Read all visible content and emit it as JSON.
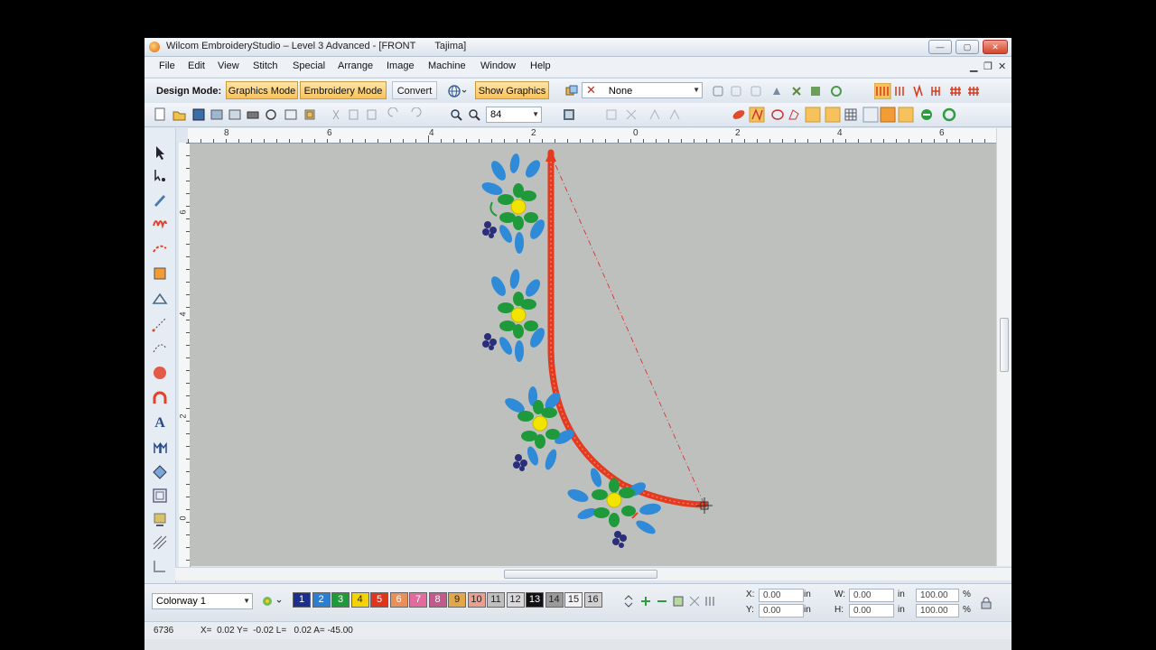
{
  "window": {
    "title": "Wilcom EmbroideryStudio – Level 3 Advanced - [FRONT       Tajima]"
  },
  "menu": [
    "File",
    "Edit",
    "View",
    "Stitch",
    "Special",
    "Arrange",
    "Image",
    "Machine",
    "Window",
    "Help"
  ],
  "toolbar": {
    "design_mode_label": "Design Mode:",
    "graphics_mode": "Graphics Mode",
    "embroidery_mode": "Embroidery Mode",
    "convert": "Convert",
    "show_graphics": "Show Graphics",
    "none_select": "None",
    "zoom_value": "84"
  },
  "ruler": {
    "h_labels": [
      "8",
      "6",
      "4",
      "2",
      "0",
      "2",
      "4",
      "6"
    ],
    "v_labels": [
      "6",
      "4",
      "2",
      "0"
    ]
  },
  "colorway": {
    "select_value": "Colorway 1",
    "swatches": [
      {
        "n": "1",
        "color": "#1d2f8c"
      },
      {
        "n": "2",
        "color": "#2c7fd0"
      },
      {
        "n": "3",
        "color": "#1f9a3a"
      },
      {
        "n": "4",
        "color": "#f3d300"
      },
      {
        "n": "5",
        "color": "#e0341c"
      },
      {
        "n": "6",
        "color": "#e88f5a"
      },
      {
        "n": "7",
        "color": "#e46a9e"
      },
      {
        "n": "8",
        "color": "#c25a8c"
      },
      {
        "n": "9",
        "color": "#e2a64b"
      },
      {
        "n": "10",
        "color": "#eaa08f"
      },
      {
        "n": "11",
        "color": "#bfbfbf"
      },
      {
        "n": "12",
        "color": "#d9d9d9"
      },
      {
        "n": "13",
        "color": "#111111"
      },
      {
        "n": "14",
        "color": "#9a9a9a"
      },
      {
        "n": "15",
        "color": "#f2f2f2"
      },
      {
        "n": "16",
        "color": "#cfcfcf"
      }
    ]
  },
  "transform": {
    "x_label": "X:",
    "x_value": "0.00",
    "y_label": "Y:",
    "y_value": "0.00",
    "w_label": "W:",
    "w_value": "0.00",
    "h_label": "H:",
    "h_value": "0.00",
    "unit": "in",
    "sx_value": "100.00",
    "sy_value": "100.00",
    "pct": "%"
  },
  "status": {
    "stitch_count": "6736",
    "coords": "X=  0.02 Y=  -0.02 L=   0.02 A= -45.00"
  },
  "colors": {
    "accent_orange": "#f7c25b",
    "stitch_red": "#e33a20"
  }
}
